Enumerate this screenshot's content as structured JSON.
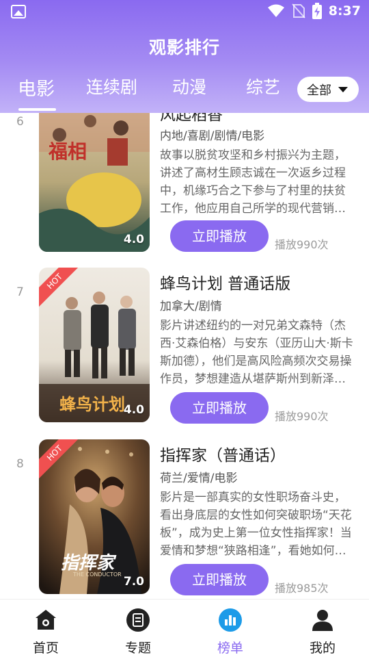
{
  "status": {
    "time": "8:37"
  },
  "header": {
    "title": "观影排行",
    "filter_label": "全部"
  },
  "tabs": [
    {
      "label": "电影"
    },
    {
      "label": "连续剧"
    },
    {
      "label": "动漫"
    },
    {
      "label": "综艺"
    }
  ],
  "movies": [
    {
      "rank": "6",
      "title": "风起稻香",
      "tags": "内地/喜剧/剧情/电影",
      "desc": "故事以脱贫攻坚和乡村振兴为主题，讲述了高材生顾志诚在一次返乡过程中，机缘巧合之下参与了村里的扶贫工作，他应用自己所学的现代营销知识……",
      "score": "4.0",
      "poster_text": "福相",
      "play_label": "立即播放",
      "plays": "播放990次"
    },
    {
      "rank": "7",
      "title": "蜂鸟计划 普通话版",
      "tags": "加拿大/剧情",
      "desc": "影片讲述纽约的一对兄弟文森特（杰西·艾森伯格）与安东（亚历山大·斯卡斯加德），他们是高风险高频次交易操作员，梦想建造从堪萨斯州到新泽西的光缆……",
      "score": "4.0",
      "hot": "HOT",
      "poster_text": "蜂鸟计划",
      "play_label": "立即播放",
      "plays": "播放990次"
    },
    {
      "rank": "8",
      "title": "指挥家（普通话）",
      "tags": "荷兰/爱情/电影",
      "desc": "影片是一部真实的女性职场奋斗史，看出身底层的女性如何突破职场“天花板”，成为史上第一位女性指挥家！当爱情和梦想“狭路相逢”，看她如何抉择……",
      "score": "7.0",
      "hot": "HOT",
      "poster_text": "指挥家",
      "poster_sub": "THE CONDUCTOR",
      "play_label": "立即播放",
      "plays": "播放985次"
    }
  ],
  "nav": [
    {
      "label": "首页",
      "icon": "home-icon"
    },
    {
      "label": "专题",
      "icon": "topic-icon"
    },
    {
      "label": "榜单",
      "icon": "ranking-icon"
    },
    {
      "label": "我的",
      "icon": "profile-icon"
    }
  ],
  "colors": {
    "accent": "#8a6af0",
    "hot": "#f05050"
  }
}
